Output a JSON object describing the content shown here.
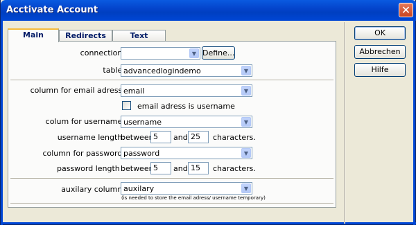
{
  "window": {
    "title": "Acctivate Account"
  },
  "tabs": [
    {
      "label": "Main",
      "active": true
    },
    {
      "label": "Redirects",
      "active": false
    },
    {
      "label": "Text",
      "active": false
    }
  ],
  "form": {
    "connection": {
      "label": "connection:",
      "value": "",
      "define_label": "Define..."
    },
    "table": {
      "label": "table:",
      "value": "advancedlogindemo"
    },
    "email_column": {
      "label": "column for email adress:",
      "value": "email"
    },
    "email_is_username": {
      "label": "email adress is username",
      "checked": false
    },
    "username_column": {
      "label": "colum for username:",
      "value": "username"
    },
    "username_length": {
      "label": "username length:",
      "between": "between",
      "min": "5",
      "and": "and",
      "max": "25",
      "suffix": "characters."
    },
    "password_column": {
      "label": "column for password:",
      "value": "password"
    },
    "password_length": {
      "label": "password length :",
      "between": "between",
      "min": "5",
      "and": "and",
      "max": "15",
      "suffix": "characters."
    },
    "auxiliary_column": {
      "label": "auxilary column:",
      "value": "auxilary",
      "hint": "(is needed to store the email adress/ username temporary)"
    }
  },
  "buttons": {
    "ok": "OK",
    "cancel": "Abbrechen",
    "help": "Hilfe"
  },
  "icons": {
    "close": "close-icon",
    "dropdown": "chevron-down-icon"
  },
  "colors": {
    "titlebar": "#0046d5",
    "active_tab_accent": "#f5ba3a",
    "close_button": "#c9431f"
  }
}
